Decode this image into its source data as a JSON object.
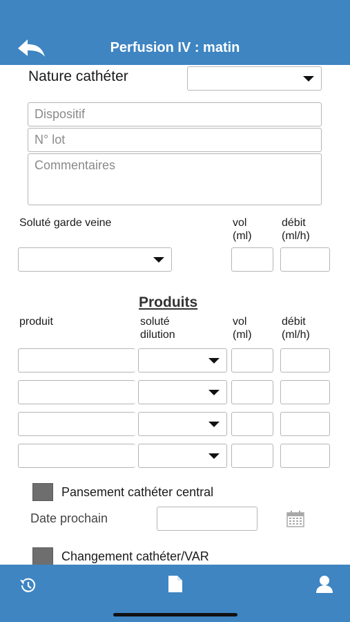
{
  "header": {
    "title": "Perfusion IV : matin",
    "back_icon": "back-arrow-icon"
  },
  "catheter": {
    "nature_label": "Nature cathéter",
    "nature_value": "",
    "dispositif_placeholder": "Dispositif",
    "lot_placeholder": "N° lot",
    "commentaires_placeholder": "Commentaires"
  },
  "solute": {
    "label": "Soluté garde veine",
    "vol_label_1": "vol",
    "vol_label_2": "(ml)",
    "debit_label_1": "débit",
    "debit_label_2": "(ml/h)"
  },
  "produits": {
    "title": "Produits",
    "col_produit": "produit",
    "col_solute_1": "soluté",
    "col_solute_2": "dilution",
    "col_vol_1": "vol",
    "col_vol_2": "(ml)",
    "col_debit_1": "débit",
    "col_debit_2": "(ml/h)",
    "rows": [
      {
        "produit": "",
        "solute": "",
        "vol": "",
        "debit": ""
      },
      {
        "produit": "",
        "solute": "",
        "vol": "",
        "debit": ""
      },
      {
        "produit": "",
        "solute": "",
        "vol": "",
        "debit": ""
      },
      {
        "produit": "",
        "solute": "",
        "vol": "",
        "debit": ""
      }
    ]
  },
  "pansement": {
    "label": "Pansement cathéter central",
    "date_label": "Date prochain",
    "date_value": "",
    "calendar_icon": "calendar-icon"
  },
  "changement": {
    "label": "Changement cathéter/VAR"
  },
  "tabbar": {
    "history_icon": "history-icon",
    "document_icon": "document-icon",
    "user_icon": "user-icon"
  },
  "colors": {
    "brand_blue": "#3e85c2",
    "checkbox_gray": "#6e6e6e",
    "border": "#b5b5b5"
  }
}
